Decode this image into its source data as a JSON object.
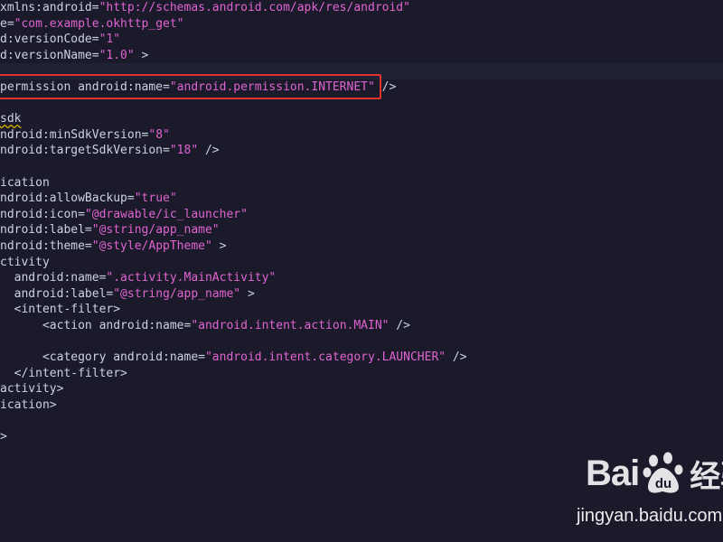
{
  "editor": {
    "colors": {
      "background": "#1a1a2b",
      "text": "#ccd3e0",
      "string": "#e064d0",
      "highlight_box": "#e0342a"
    },
    "lines": [
      [
        {
          "t": "xmlns:android=",
          "c": "plain"
        },
        {
          "t": "\"http://schemas.android.com/apk/res/android\"",
          "c": "str"
        }
      ],
      [
        {
          "t": "e=",
          "c": "plain"
        },
        {
          "t": "\"com.example.okhttp_get\"",
          "c": "str"
        }
      ],
      [
        {
          "t": "d:versionCode=",
          "c": "plain"
        },
        {
          "t": "\"1\"",
          "c": "str"
        }
      ],
      [
        {
          "t": "d:versionName=",
          "c": "plain"
        },
        {
          "t": "\"1.0\"",
          "c": "str"
        },
        {
          "t": " >",
          "c": "plain"
        }
      ],
      [
        {
          "t": "",
          "c": "plain"
        }
      ],
      [
        {
          "t": "permission android:name=",
          "c": "plain"
        },
        {
          "t": "\"android.permission.INTERNET\"",
          "c": "str"
        },
        {
          "t": " />",
          "c": "plain"
        }
      ],
      [
        {
          "t": "",
          "c": "plain"
        }
      ],
      [
        {
          "t": "sdk",
          "c": "sq"
        }
      ],
      [
        {
          "t": "ndroid:minSdkVersion=",
          "c": "plain"
        },
        {
          "t": "\"8\"",
          "c": "str"
        }
      ],
      [
        {
          "t": "ndroid:targetSdkVersion=",
          "c": "plain"
        },
        {
          "t": "\"18\"",
          "c": "str"
        },
        {
          "t": " />",
          "c": "plain"
        }
      ],
      [
        {
          "t": "",
          "c": "plain"
        }
      ],
      [
        {
          "t": "ication",
          "c": "plain"
        }
      ],
      [
        {
          "t": "ndroid:allowBackup=",
          "c": "plain"
        },
        {
          "t": "\"true\"",
          "c": "str"
        }
      ],
      [
        {
          "t": "ndroid:icon=",
          "c": "plain"
        },
        {
          "t": "\"@drawable/ic_launcher\"",
          "c": "str"
        }
      ],
      [
        {
          "t": "ndroid:label=",
          "c": "plain"
        },
        {
          "t": "\"@string/app_name\"",
          "c": "str"
        }
      ],
      [
        {
          "t": "ndroid:theme=",
          "c": "plain"
        },
        {
          "t": "\"@style/AppTheme\"",
          "c": "str"
        },
        {
          "t": " >",
          "c": "plain"
        }
      ],
      [
        {
          "t": "ctivity",
          "c": "plain"
        }
      ],
      [
        {
          "t": "  android:name=",
          "c": "plain"
        },
        {
          "t": "\".activity.MainActivity\"",
          "c": "str"
        }
      ],
      [
        {
          "t": "  android:label=",
          "c": "plain"
        },
        {
          "t": "\"@string/app_name\"",
          "c": "str"
        },
        {
          "t": " >",
          "c": "plain"
        }
      ],
      [
        {
          "t": "  <intent-filter>",
          "c": "plain"
        }
      ],
      [
        {
          "t": "      <action android:name=",
          "c": "plain"
        },
        {
          "t": "\"android.intent.action.MAIN\"",
          "c": "str"
        },
        {
          "t": " />",
          "c": "plain"
        }
      ],
      [
        {
          "t": "",
          "c": "plain"
        }
      ],
      [
        {
          "t": "      <category android:name=",
          "c": "plain"
        },
        {
          "t": "\"android.intent.category.LAUNCHER\"",
          "c": "str"
        },
        {
          "t": " />",
          "c": "plain"
        }
      ],
      [
        {
          "t": "  </intent-filter>",
          "c": "plain"
        }
      ],
      [
        {
          "t": "activity>",
          "c": "plain"
        }
      ],
      [
        {
          "t": "ication>",
          "c": "plain"
        }
      ],
      [
        {
          "t": "",
          "c": "plain"
        }
      ],
      [
        {
          "t": ">",
          "c": "plain"
        }
      ]
    ]
  },
  "watermark": {
    "logo_left": "Bai",
    "logo_mid": "du",
    "logo_right": "经验",
    "url": "jingyan.baidu.com"
  }
}
